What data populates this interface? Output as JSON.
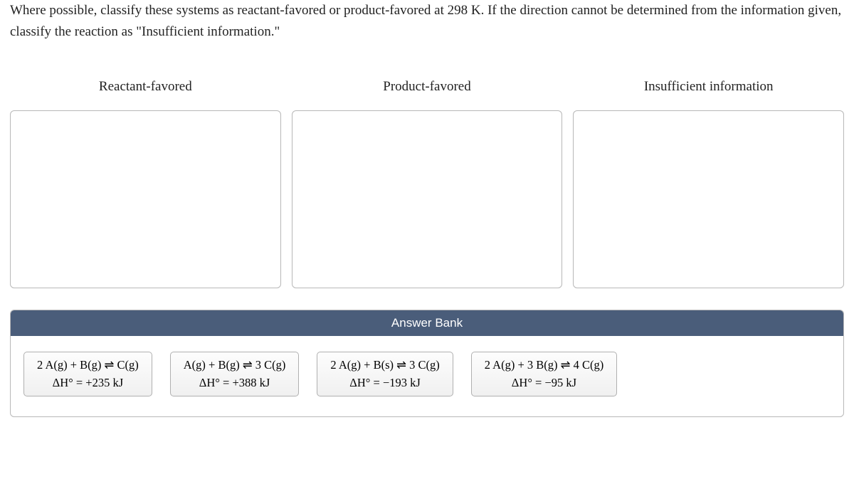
{
  "question": "Where possible, classify these systems as reactant-favored or product-favored at 298 K. If the direction cannot be determined from the information given, classify the reaction as \"Insufficient information.\"",
  "categories": [
    {
      "label": "Reactant-favored"
    },
    {
      "label": "Product-favored"
    },
    {
      "label": "Insufficient information"
    }
  ],
  "answerBank": {
    "title": "Answer Bank",
    "items": [
      {
        "reaction": "2 A(g) + B(g) ⇌ C(g)",
        "enthalpy": "ΔH° = +235 kJ"
      },
      {
        "reaction": "A(g) + B(g) ⇌ 3 C(g)",
        "enthalpy": "ΔH° = +388 kJ"
      },
      {
        "reaction": "2 A(g) + B(s) ⇌ 3 C(g)",
        "enthalpy": "ΔH° = −193 kJ"
      },
      {
        "reaction": "2 A(g) + 3 B(g) ⇌ 4 C(g)",
        "enthalpy": "ΔH° = −95 kJ"
      }
    ]
  }
}
